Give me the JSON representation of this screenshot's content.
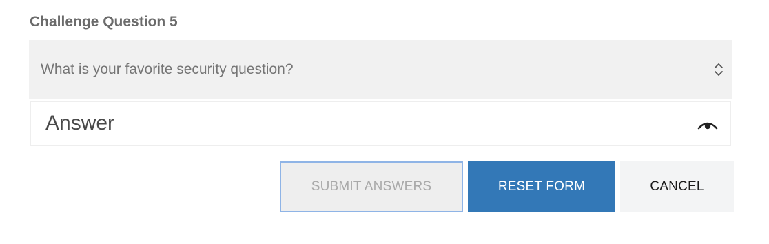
{
  "challenge": {
    "heading": "Challenge Question 5",
    "question_select": {
      "selected": "What is your favorite security question?",
      "icon": "updown-chevron-icon"
    },
    "answer": {
      "value": "",
      "placeholder": "Answer",
      "toggle_icon": "eye-icon"
    }
  },
  "actions": {
    "submit_label": "SUBMIT ANSWERS",
    "reset_label": "RESET FORM",
    "cancel_label": "CANCEL"
  },
  "colors": {
    "primary": "#3378b7",
    "submit_border": "#8fb4e6",
    "disabled_text": "#a9a9a9",
    "select_bg": "#f1f1f1"
  }
}
